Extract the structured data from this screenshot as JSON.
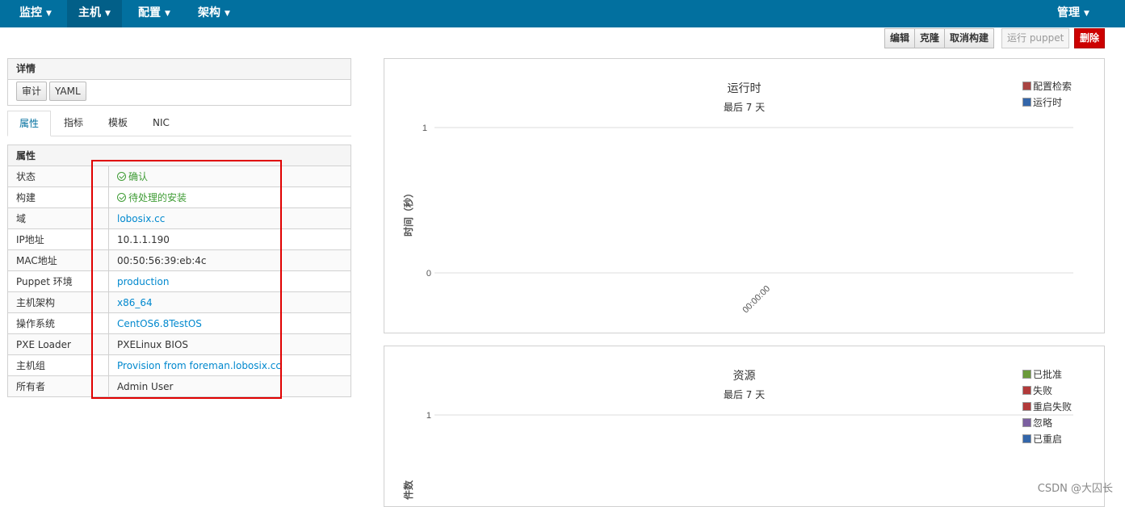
{
  "nav": {
    "items": [
      {
        "label": "监控"
      },
      {
        "label": "主机"
      },
      {
        "label": "配置"
      },
      {
        "label": "架构"
      }
    ],
    "admin": "管理"
  },
  "actions": {
    "edit": "编辑",
    "clone": "克隆",
    "cancel_build": "取消构建",
    "run_puppet": "运行 puppet",
    "delete": "删除"
  },
  "details": {
    "title": "详情",
    "audit": "审计",
    "yaml": "YAML"
  },
  "tabs": [
    {
      "label": "属性"
    },
    {
      "label": "指标"
    },
    {
      "label": "模板"
    },
    {
      "label": "NIC"
    }
  ],
  "properties": {
    "header": "属性",
    "rows": [
      {
        "key": "状态",
        "value": "确认"
      },
      {
        "key": "构建",
        "value": "待处理的安装"
      },
      {
        "key": "域",
        "value": "lobosix.cc"
      },
      {
        "key": "IP地址",
        "value": "10.1.1.190"
      },
      {
        "key": "MAC地址",
        "value": "00:50:56:39:eb:4c"
      },
      {
        "key": "Puppet 环境",
        "value": "production"
      },
      {
        "key": "主机架构",
        "value": "x86_64"
      },
      {
        "key": "操作系统",
        "value": "CentOS6.8TestOS"
      },
      {
        "key": "PXE Loader",
        "value": "PXELinux BIOS"
      },
      {
        "key": "主机组",
        "value": "Provision from foreman.lobosix.cc"
      },
      {
        "key": "所有者",
        "value": "Admin User"
      }
    ]
  },
  "runtime_chart": {
    "title": "运行时",
    "subtitle": "最后 7 天",
    "ylabel": "时间（秒）",
    "y_ticks": [
      "1",
      "0"
    ],
    "x_ticks": [
      "00:00:00"
    ],
    "legend": [
      {
        "label": "配置检索",
        "color": "#a94442"
      },
      {
        "label": "运行时",
        "color": "#3366aa"
      }
    ]
  },
  "resources_chart": {
    "title": "资源",
    "subtitle": "最后 7 天",
    "ylabel": "件数",
    "y_ticks": [
      "1"
    ],
    "legend": [
      {
        "label": "已批准",
        "color": "#6a9a3a"
      },
      {
        "label": "失败",
        "color": "#b23a3a"
      },
      {
        "label": "重启失败",
        "color": "#b23a3a"
      },
      {
        "label": "忽略",
        "color": "#7b5fa0"
      },
      {
        "label": "已重启",
        "color": "#3366aa"
      }
    ]
  },
  "watermark": "CSDN @大囚长"
}
